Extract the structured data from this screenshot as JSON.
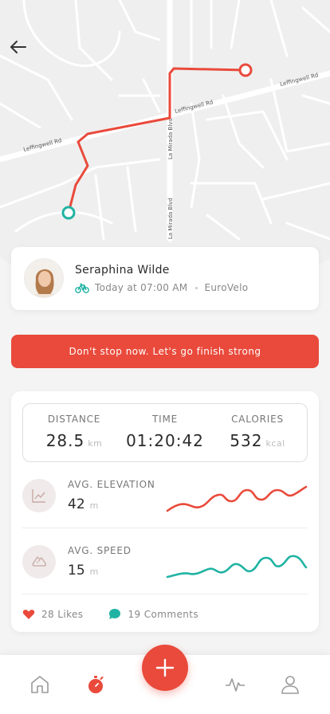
{
  "map": {
    "roads": [
      "Leffingwell Rd",
      "Leffingwell Rd",
      "Leffingwell Rd",
      "La Mirada Blvd",
      "La Mirada Blvd"
    ]
  },
  "profile": {
    "name": "Seraphina Wilde",
    "time": "Today at 07:00 AM",
    "route": "EuroVelo",
    "activity_icon": "bicycle-icon"
  },
  "banner": {
    "text": "Don't stop now. Let's go finish strong"
  },
  "summary": {
    "distance": {
      "label": "DISTANCE",
      "value": "28.5",
      "unit": "km"
    },
    "time": {
      "label": "TIME",
      "value": "01:20:42"
    },
    "calories": {
      "label": "CALORIES",
      "value": "532",
      "unit": "kcal"
    }
  },
  "metrics": {
    "elevation": {
      "label": "AVG. ELEVATION",
      "value": "42",
      "unit": "m",
      "color": "#e94a3b"
    },
    "speed": {
      "label": "AVG. SPEED",
      "value": "15",
      "unit": "m",
      "color": "#20b3a3"
    }
  },
  "social": {
    "likes": "28 Likes",
    "comments": "19 Comments"
  },
  "colors": {
    "accent": "#e94a3b",
    "teal": "#20b3a3"
  },
  "nav": {
    "items": [
      "home-icon",
      "stopwatch-icon",
      "add-icon",
      "activity-icon",
      "profile-icon"
    ]
  }
}
